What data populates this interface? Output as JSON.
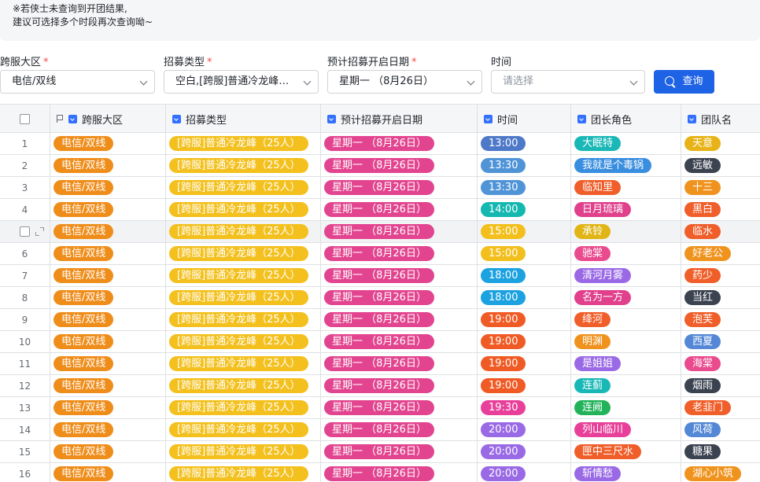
{
  "notice": {
    "line1": "※若侠士未查询到开团结果,",
    "line2": "建议可选择多个时段再次查询呦~"
  },
  "filters": {
    "region": {
      "label": "跨服大区",
      "required_mark": "*",
      "value": "电信/双线"
    },
    "recruit_type": {
      "label": "招募类型",
      "required_mark": "*",
      "value": "空白,[跨服]普通冷龙峰（25人）"
    },
    "date": {
      "label": "预计招募开启日期",
      "required_mark": "*",
      "value": "星期一 （8月26日）"
    },
    "time": {
      "label": "时间",
      "placeholder": "请选择"
    },
    "query_button": "查询"
  },
  "table": {
    "columns": [
      "跨服大区",
      "招募类型",
      "预计招募开启日期",
      "时间",
      "团长角色",
      "团队名"
    ],
    "rows": [
      {
        "no": "1",
        "region": "电信/双线",
        "type": "[跨服]普通冷龙峰（25人）",
        "date": "星期一 （8月26日）",
        "time": "13:00",
        "leader": "大眠特",
        "team": "天意"
      },
      {
        "no": "2",
        "region": "电信/双线",
        "type": "[跨服]普通冷龙峰（25人）",
        "date": "星期一 （8月26日）",
        "time": "13:30",
        "leader": "我就是个毒锅",
        "team": "远敏"
      },
      {
        "no": "3",
        "region": "电信/双线",
        "type": "[跨服]普通冷龙峰（25人）",
        "date": "星期一 （8月26日）",
        "time": "13:30",
        "leader": "临知里",
        "team": "十三"
      },
      {
        "no": "4",
        "region": "电信/双线",
        "type": "[跨服]普通冷龙峰（25人）",
        "date": "星期一 （8月26日）",
        "time": "14:00",
        "leader": "日月琉璃",
        "team": "黑白"
      },
      {
        "no": "",
        "region": "电信/双线",
        "type": "[跨服]普通冷龙峰（25人）",
        "date": "星期一 （8月26日）",
        "time": "15:00",
        "leader": "承铃",
        "team": "临水"
      },
      {
        "no": "6",
        "region": "电信/双线",
        "type": "[跨服]普通冷龙峰（25人）",
        "date": "星期一 （8月26日）",
        "time": "15:00",
        "leader": "驰棠",
        "team": "好老公"
      },
      {
        "no": "7",
        "region": "电信/双线",
        "type": "[跨服]普通冷龙峰（25人）",
        "date": "星期一 （8月26日）",
        "time": "18:00",
        "leader": "清河月雾",
        "team": "药少"
      },
      {
        "no": "8",
        "region": "电信/双线",
        "type": "[跨服]普通冷龙峰（25人）",
        "date": "星期一 （8月26日）",
        "time": "18:00",
        "leader": "名为一方",
        "team": "当红"
      },
      {
        "no": "9",
        "region": "电信/双线",
        "type": "[跨服]普通冷龙峰（25人）",
        "date": "星期一 （8月26日）",
        "time": "19:00",
        "leader": "绛河",
        "team": "泡芙"
      },
      {
        "no": "10",
        "region": "电信/双线",
        "type": "[跨服]普通冷龙峰（25人）",
        "date": "星期一 （8月26日）",
        "time": "19:00",
        "leader": "明渊",
        "team": "西夏"
      },
      {
        "no": "11",
        "region": "电信/双线",
        "type": "[跨服]普通冷龙峰（25人）",
        "date": "星期一 （8月26日）",
        "time": "19:00",
        "leader": "是姐姐",
        "team": "海棠"
      },
      {
        "no": "12",
        "region": "电信/双线",
        "type": "[跨服]普通冷龙峰（25人）",
        "date": "星期一 （8月26日）",
        "time": "19:00",
        "leader": "连蓟",
        "team": "烟雨"
      },
      {
        "no": "13",
        "region": "电信/双线",
        "type": "[跨服]普通冷龙峰（25人）",
        "date": "星期一 （8月26日）",
        "time": "19:30",
        "leader": "连阙",
        "team": "老韭门"
      },
      {
        "no": "14",
        "region": "电信/双线",
        "type": "[跨服]普通冷龙峰（25人）",
        "date": "星期一 （8月26日）",
        "time": "20:00",
        "leader": "列山临川",
        "team": "风荷"
      },
      {
        "no": "15",
        "region": "电信/双线",
        "type": "[跨服]普通冷龙峰（25人）",
        "date": "星期一 （8月26日）",
        "time": "20:00",
        "leader": "匣中三尺水",
        "team": "糖果"
      },
      {
        "no": "16",
        "region": "电信/双线",
        "type": "[跨服]普通冷龙峰（25人）",
        "date": "星期一 （8月26日）",
        "time": "20:00",
        "leader": "斩情愁",
        "team": "湖心小筑"
      }
    ]
  },
  "colors": {
    "region_tag": "#ef8d1b",
    "type_tag": "#f3c01d",
    "date_tag": "#e2448f",
    "time": {
      "13:00": "#4e78c8",
      "13:30": "#5094d8",
      "14:00": "#14b8b0",
      "15:00": "#f2bf1c",
      "18:00": "#1ca2e1",
      "19:00": "#f05a24",
      "19:30": "#e8409a",
      "20:00": "#9a6ae6"
    },
    "leader": [
      "#19b8b6",
      "#3a8ee0",
      "#f05e2a",
      "#e0408c",
      "#e0b516",
      "#ea4a8e",
      "#9a6ae6",
      "#e0408c",
      "#f05e2a",
      "#f0931e",
      "#9a6ae6",
      "#19b8b6",
      "#22b35a",
      "#e8409a",
      "#f05e2a",
      "#9a6ae6"
    ],
    "team": [
      "#e8b318",
      "#3b4250",
      "#f0931e",
      "#f05e2a",
      "#f05e2a",
      "#f0931e",
      "#f05e2a",
      "#3b4250",
      "#f05e2a",
      "#5488d6",
      "#ea4a8e",
      "#3b4250",
      "#f05e2a",
      "#5488d6",
      "#3b4250",
      "#f0931e"
    ]
  },
  "icons": {
    "header_checkbox": "checkbox-icon",
    "primary_field": "flag-icon",
    "field_type": "single-select-field-icon",
    "search": "search-icon",
    "expand": "expand-icon"
  }
}
